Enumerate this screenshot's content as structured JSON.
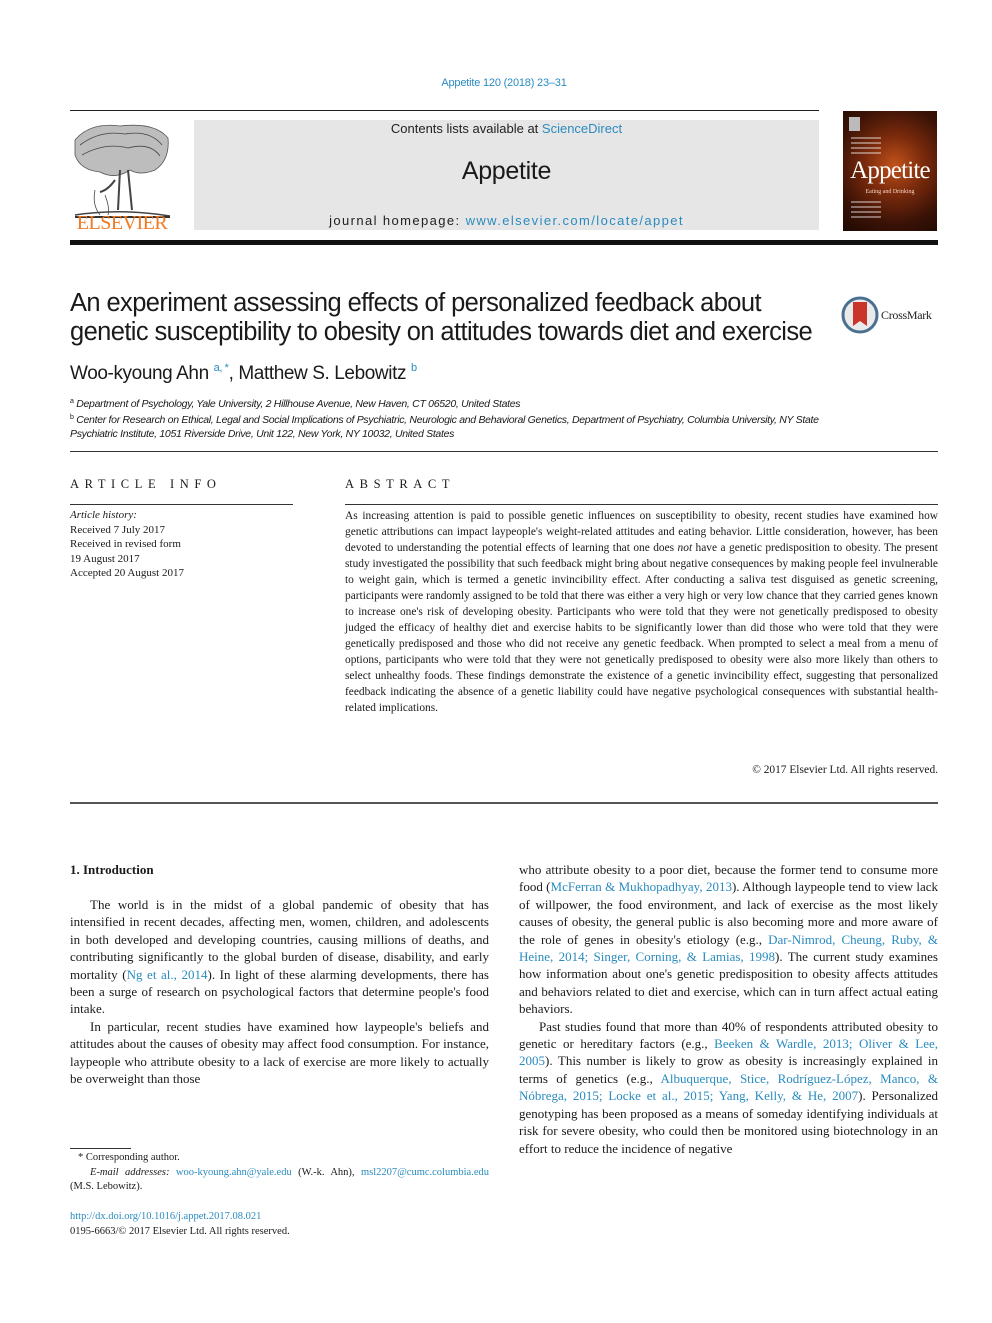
{
  "citation": "Appetite 120 (2018) 23–31",
  "header": {
    "publisher_logo": "ELSEVIER",
    "contents_prefix": "Contents lists available at ",
    "contents_link": "ScienceDirect",
    "journal_name": "Appetite",
    "homepage_prefix": "journal homepage: ",
    "homepage_link": "www.elsevier.com/locate/appet",
    "cover_title": "Appetite",
    "cover_subtitle": "Eating and Drinking"
  },
  "crossmark_label": "CrossMark",
  "article": {
    "title": "An experiment assessing effects of personalized feedback about genetic susceptibility to obesity on attitudes towards diet and exercise",
    "authors": [
      {
        "name": "Woo-kyoung Ahn",
        "sup": "a, *"
      },
      {
        "name": "Matthew S. Lebowitz",
        "sup": "b"
      }
    ],
    "author_separator": ", ",
    "affiliations": [
      {
        "key": "a",
        "text": "Department of Psychology, Yale University, 2 Hillhouse Avenue, New Haven, CT 06520, United States"
      },
      {
        "key": "b",
        "text": "Center for Research on Ethical, Legal and Social Implications of Psychiatric, Neurologic and Behavioral Genetics, Department of Psychiatry, Columbia University, NY State Psychiatric Institute, 1051 Riverside Drive, Unit 122, New York, NY 10032, United States"
      }
    ]
  },
  "article_info": {
    "heading": "ARTICLE INFO",
    "history_label": "Article history:",
    "history": [
      "Received 7 July 2017",
      "Received in revised form",
      "19 August 2017",
      "Accepted 20 August 2017"
    ]
  },
  "abstract": {
    "heading": "ABSTRACT",
    "text_part1": "As increasing attention is paid to possible genetic influences on susceptibility to obesity, recent studies have examined how genetic attributions can impact laypeople's weight-related attitudes and eating behavior. Little consideration, however, has been devoted to understanding the potential effects of learning that one does ",
    "text_italic": "not",
    "text_part2": " have a genetic predisposition to obesity. The present study investigated the possibility that such feedback might bring about negative consequences by making people feel invul­nerable to weight gain, which is termed a genetic invincibility effect. After conducting a saliva test disguised as genetic screening, participants were randomly assigned to be told that there was either a very high or very low chance that they carried genes known to increase one's risk of developing obesity. Participants who were told that they were not genetically predisposed to obesity judged the efficacy of healthy diet and exercise habits to be significantly lower than did those who were told that they were genetically predisposed and those who did not receive any genetic feedback. When prompted to select a meal from a menu of options, participants who were told that they were not genetically predisposed to obesity were also more likely than others to select unhealthy foods. These findings demonstrate the existence of a genetic invincibility effect, suggesting that personalized feedback indicating the absence of a genetic liability could have negative psychological consequences with substantial health-related implications.",
    "copyright": "© 2017 Elsevier Ltd. All rights reserved."
  },
  "intro": {
    "heading": "1.  Introduction",
    "p1_a": "The world is in the midst of a global pandemic of obesity that has intensified in recent decades, affecting men, women, children, and adolescents in both developed and developing countries, causing millions of deaths, and contributing significantly to the global burden of disease, disability, and early mortality (",
    "p1_link": "Ng et al., 2014",
    "p1_b": "). In light of these alarming developments, there has been a surge of research on psychological factors that determine people's food intake.",
    "p2": "In particular, recent studies have examined how laypeople's beliefs and attitudes about the causes of obesity may affect food consumption. For instance, laypeople who attribute obesity to a lack of exercise are more likely to actually be overweight than those",
    "p2_cont_a": "who attribute obesity to a poor diet, because the former tend to consume more food (",
    "p2_cont_link1": "McFerran & Mukhopadhyay, 2013",
    "p2_cont_b": "). Although laypeople tend to view lack of willpower, the food environment, and lack of exercise as the most likely causes of obesity, the general public is also becoming more and more aware of the role of genes in obesity's etiology (e.g., ",
    "p2_cont_link2": "Dar-Nimrod, Cheung, Ruby, & Heine, 2014; Singer, Corning, & Lamias, 1998",
    "p2_cont_c": "). The current study examines how information about one's genetic predisposition to obesity af­fects attitudes and behaviors related to diet and exercise, which can in turn affect actual eating behaviors.",
    "p3_a": "Past studies found that more than 40% of respondents attributed obesity to genetic or hereditary factors (e.g., ",
    "p3_link1": "Beeken & Wardle, 2013; Oliver & Lee, 2005",
    "p3_b": "). This number is likely to grow as obesity is increasingly explained in terms of genetics (e.g., ",
    "p3_link2": "Albuquerque, Stice, Rodríguez-López, Manco, & Nóbrega, 2015; Locke et al., 2015; Yang, Kelly, & He, 2007",
    "p3_c": "). Personalized genotyp­ing has been proposed as a means of someday identifying in­dividuals at risk for severe obesity, who could then be monitored using biotechnology in an effort to reduce the incidence of negative"
  },
  "footnotes": {
    "corresponding": "* Corresponding author.",
    "email_label": "E-mail addresses:",
    "email1": "woo-kyoung.ahn@yale.edu",
    "email1_owner": " (W.-k. Ahn), ",
    "email2": "msl2207@cumc.columbia.edu",
    "email2_owner": " (M.S. Lebowitz).",
    "doi": "http://dx.doi.org/10.1016/j.appet.2017.08.021",
    "issn": "0195-6663/© 2017 Elsevier Ltd. All rights reserved."
  },
  "colors": {
    "link": "#2a8bbf",
    "elsevier_orange": "#f07a22",
    "header_box": "#e6e6e6"
  }
}
